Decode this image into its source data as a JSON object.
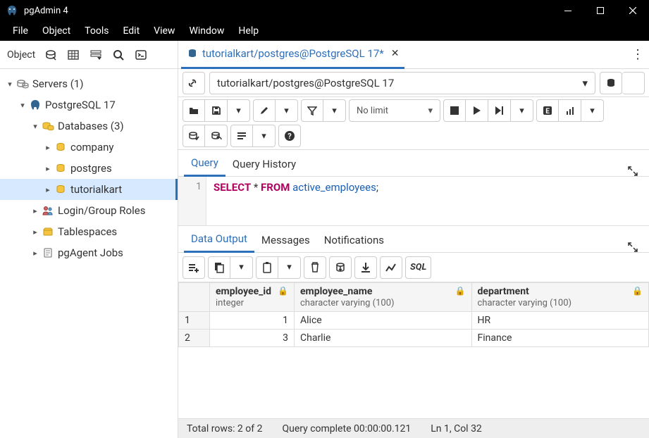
{
  "window": {
    "title": "pgAdmin 4"
  },
  "menubar": [
    "File",
    "Object",
    "Tools",
    "Edit",
    "View",
    "Window",
    "Help"
  ],
  "sidebar": {
    "label": "Object",
    "tree": {
      "servers": "Servers (1)",
      "pg": "PostgreSQL 17",
      "databases": "Databases (3)",
      "db_company": "company",
      "db_postgres": "postgres",
      "db_tutorialkart": "tutorialkart",
      "login_roles": "Login/Group Roles",
      "tablespaces": "Tablespaces",
      "pgagent": "pgAgent Jobs"
    }
  },
  "tab": {
    "title": "tutorialkart/postgres@PostgreSQL 17*"
  },
  "conn": {
    "text": "tutorialkart/postgres@PostgreSQL 17"
  },
  "toolbar": {
    "limit": "No limit"
  },
  "editor_tabs": {
    "query": "Query",
    "history": "Query History"
  },
  "query": {
    "ln": "1",
    "sel": "SELECT",
    "star": " * ",
    "from": "FROM",
    "sp": " ",
    "ident": "active_employees",
    "semi": ";"
  },
  "output_tabs": {
    "data": "Data Output",
    "messages": "Messages",
    "notifications": "Notifications"
  },
  "sql_label": "SQL",
  "columns": {
    "c0": {
      "name": "employee_id",
      "type": "integer"
    },
    "c1": {
      "name": "employee_name",
      "type": "character varying (100)"
    },
    "c2": {
      "name": "department",
      "type": "character varying (100)"
    }
  },
  "rows": {
    "r0": {
      "n": "1",
      "id": "1",
      "name": "Alice",
      "dept": "HR"
    },
    "r1": {
      "n": "2",
      "id": "3",
      "name": "Charlie",
      "dept": "Finance"
    }
  },
  "status": {
    "total": "Total rows: 2 of 2",
    "time": "Query complete 00:00:00.121",
    "pos": "Ln 1, Col 32"
  }
}
